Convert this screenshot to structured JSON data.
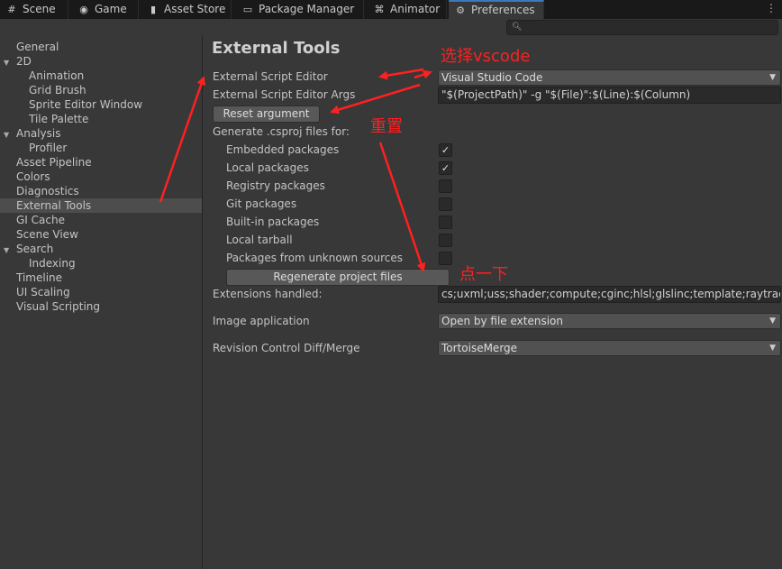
{
  "tabs": [
    {
      "label": "Scene",
      "icon": "grid-icon"
    },
    {
      "label": "Game",
      "icon": "gamepad-icon"
    },
    {
      "label": "Asset Store",
      "icon": "bag-icon"
    },
    {
      "label": "Package Manager",
      "icon": "package-icon"
    },
    {
      "label": "Animator",
      "icon": "animator-icon"
    },
    {
      "label": "Preferences",
      "icon": "gear-icon"
    }
  ],
  "search": {
    "placeholder": ""
  },
  "sidebar": {
    "items": [
      {
        "label": "General"
      },
      {
        "label": "2D"
      },
      {
        "label": "Animation"
      },
      {
        "label": "Grid Brush"
      },
      {
        "label": "Sprite Editor Window"
      },
      {
        "label": "Tile Palette"
      },
      {
        "label": "Analysis"
      },
      {
        "label": "Profiler"
      },
      {
        "label": "Asset Pipeline"
      },
      {
        "label": "Colors"
      },
      {
        "label": "Diagnostics"
      },
      {
        "label": "External Tools"
      },
      {
        "label": "GI Cache"
      },
      {
        "label": "Scene View"
      },
      {
        "label": "Search"
      },
      {
        "label": "Indexing"
      },
      {
        "label": "Timeline"
      },
      {
        "label": "UI Scaling"
      },
      {
        "label": "Visual Scripting"
      }
    ],
    "selected": "External Tools"
  },
  "main": {
    "title": "External Tools",
    "script_editor_label": "External Script Editor",
    "script_editor_value": "Visual Studio Code",
    "args_label": "External Script Editor Args",
    "args_value": "\"$(ProjectPath)\" -g \"$(File)\":$(Line):$(Column)",
    "reset_label": "Reset argument",
    "generate_label": "Generate .csproj files for:",
    "packages": [
      {
        "label": "Embedded packages",
        "checked": true
      },
      {
        "label": "Local packages",
        "checked": true
      },
      {
        "label": "Registry packages",
        "checked": false
      },
      {
        "label": "Git packages",
        "checked": false
      },
      {
        "label": "Built-in packages",
        "checked": false
      },
      {
        "label": "Local tarball",
        "checked": false
      },
      {
        "label": "Packages from unknown sources",
        "checked": false
      }
    ],
    "regenerate_label": "Regenerate project files",
    "extensions_label": "Extensions handled:",
    "extensions_value": "cs;uxml;uss;shader;compute;cginc;hlsl;glslinc;template;raytrace;txt",
    "image_app_label": "Image application",
    "image_app_value": "Open by file extension",
    "revision_label": "Revision Control Diff/Merge",
    "revision_value": "TortoiseMerge"
  },
  "annotations": {
    "select_vscode": "选择vscode",
    "reset": "重置",
    "click": "点一下"
  },
  "check_mark": "✓",
  "colors": {
    "accent": "#3a79bb",
    "annotation": "#ff2020"
  }
}
